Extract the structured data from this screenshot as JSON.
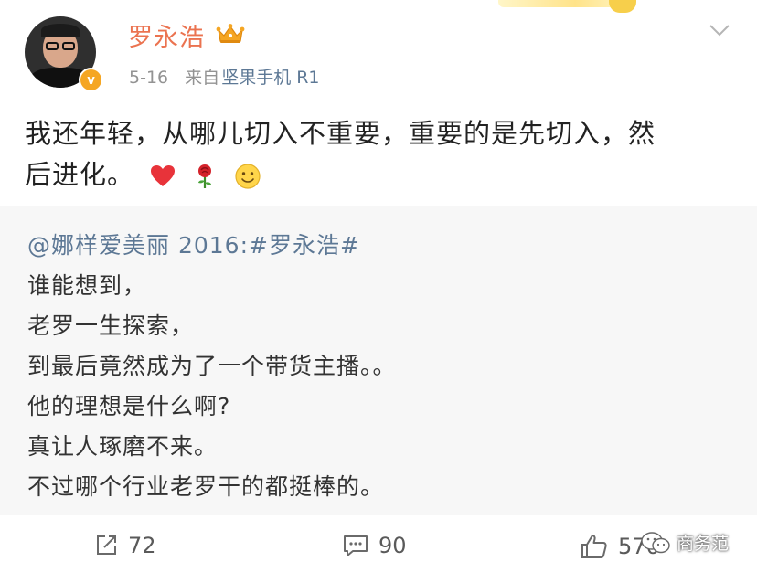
{
  "post": {
    "username": "罗永浩",
    "date": "5-16",
    "source_prefix": "来自",
    "source_device": "坚果手机 R1",
    "verified_badge": "v",
    "text_line1": "我还年轻，从哪儿切入不重要，重要的是先切入，然",
    "text_line2": "后进化。",
    "emojis": [
      "heart-icon",
      "rose-icon",
      "smile-icon"
    ]
  },
  "repost": {
    "author": "@娜样爱美丽 2016:",
    "hashtag": "#罗永浩#",
    "lines": [
      "谁能想到，",
      "老罗一生探索，",
      "到最后竟然成为了一个带货主播。。",
      "他的理想是什么啊?",
      "真让人琢磨不来。",
      "不过哪个行业老罗干的都挺棒的。"
    ]
  },
  "actions": {
    "repost_count": "72",
    "comment_count": "90",
    "like_count": "570"
  },
  "watermark": "商务范",
  "colors": {
    "username": "#eb7350",
    "link": "#5d7895",
    "repost_bg": "#f7f7f7",
    "meta": "#939393"
  }
}
